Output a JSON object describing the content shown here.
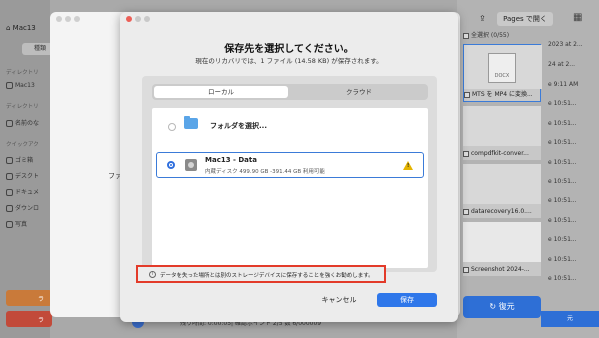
{
  "background_app": {
    "home_label": "Mac13",
    "tab_label": "種類",
    "sidebar_sections": [
      {
        "label": "ディレクトリ"
      },
      {
        "label": "Mac13"
      },
      {
        "label": "ディレクトリ"
      },
      {
        "label": "名前のな"
      },
      {
        "label": "クイックアク"
      },
      {
        "label": "ゴミ箱"
      },
      {
        "label": "デスクト"
      },
      {
        "label": "ドキュメ"
      },
      {
        "label": "ダウンロ"
      },
      {
        "label": "写真"
      }
    ],
    "sidebar_btn_orange": "ラ",
    "sidebar_btn_red": "ラ",
    "mid_window_text": "ファ",
    "bottom_status": "残り時間: 0:00:05| 確認ポイント 2/5 数 6/000009",
    "right_header": {
      "pages_btn": "Pages で開く"
    },
    "select_all": "全選択 (0/55)",
    "files": [
      {
        "name": "MTS を MP4 に変換...",
        "thumb_text": "DOCX"
      },
      {
        "name": "compdfkit-conver..."
      },
      {
        "name": "datarecovery16.0...."
      },
      {
        "name": "Screenshot 2024-..."
      },
      {
        "name": ""
      }
    ],
    "dates": [
      "2023 at 2...",
      "24 at 2...",
      "e 9:11 AM",
      "e 10:51...",
      "e 10:51...",
      "e 10:51...",
      "e 10:51...",
      "e 10:51...",
      "e 10:51...",
      "e 10:51...",
      "e 10:51...",
      "e 10:51...",
      "e 10:51...",
      "e 10:51..."
    ],
    "restore_btn": "復元",
    "right_btn2": "元"
  },
  "dialog": {
    "title": "保存先を選択してください。",
    "subtitle": "現在のリカバリでは、1 ファイル (14.58 KB) が保存されます。",
    "tabs": {
      "local": "ローカル",
      "cloud": "クラウド"
    },
    "folder_label": "フォルダを選択...",
    "drive": {
      "name": "Mac13 - Data",
      "info": "内蔵ディスク 499.90 GB -391.44 GB 利用可能"
    },
    "notice": "データを失った場所とは別のストレージデバイスに保存することを強くお勧めします。",
    "cancel": "キャンセル",
    "save": "保存"
  },
  "colors": {
    "accent": "#2f77ea",
    "highlight_border": "#e33b2a",
    "warning": "#e5b400"
  },
  "icons": [
    "home-icon",
    "folder-icon",
    "drive-icon",
    "warning-icon",
    "info-icon",
    "share-icon",
    "grid-icon",
    "restore-icon"
  ]
}
